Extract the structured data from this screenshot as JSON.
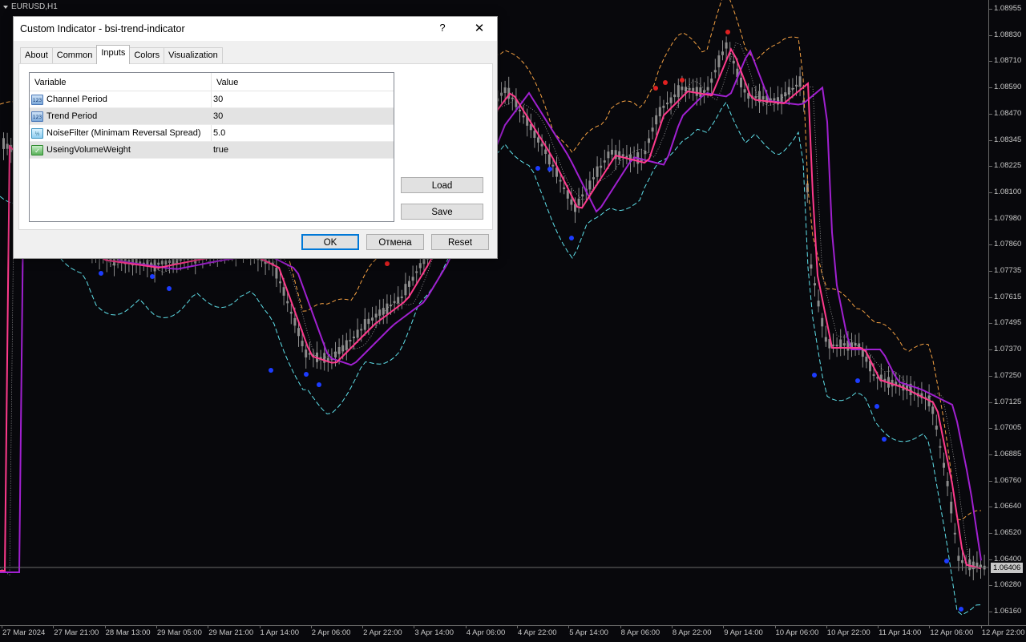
{
  "chart": {
    "symbol": "EURUSD,H1",
    "current_price": "1.06406",
    "price_labels": [
      "1.08955",
      "1.08830",
      "1.08710",
      "1.08590",
      "1.08470",
      "1.08345",
      "1.08225",
      "1.08100",
      "1.07980",
      "1.07860",
      "1.07735",
      "1.07615",
      "1.07495",
      "1.07370",
      "1.07250",
      "1.07125",
      "1.07005",
      "1.06885",
      "1.06760",
      "1.06640",
      "1.06520",
      "1.06400",
      "1.06280",
      "1.06160"
    ],
    "time_labels": [
      "27 Mar 2024",
      "27 Mar 21:00",
      "28 Mar 13:00",
      "29 Mar 05:00",
      "29 Mar 21:00",
      "1 Apr 14:00",
      "2 Apr 06:00",
      "2 Apr 22:00",
      "3 Apr 14:00",
      "4 Apr 06:00",
      "4 Apr 22:00",
      "5 Apr 14:00",
      "8 Apr 06:00",
      "8 Apr 22:00",
      "9 Apr 14:00",
      "10 Apr 06:00",
      "10 Apr 22:00",
      "11 Apr 14:00",
      "12 Apr 06:00",
      "12 Apr 22:00"
    ],
    "colors": {
      "background": "#08080c",
      "candle": "#8c8c8c",
      "upper_channel": "#f5a142",
      "lower_channel": "#5fe0ea",
      "trend_fast": "#ff3a8c",
      "trend_slow": "#a020d0",
      "reversal_up_dot": "#e02020",
      "reversal_down_dot": "#1c3cff",
      "guide_dots": "#bbbbbb",
      "price_line": "#6a6a6a"
    }
  },
  "dialog": {
    "title": "Custom Indicator - bsi-trend-indicator",
    "help_glyph": "?",
    "close_glyph": "✕",
    "tabs": [
      "About",
      "Common",
      "Inputs",
      "Colors",
      "Visualization"
    ],
    "active_tab": "Inputs",
    "grid": {
      "headers": [
        "Variable",
        "Value"
      ],
      "rows": [
        {
          "icon": "int",
          "icon_text": "123",
          "variable": "Channel Period",
          "value": "30"
        },
        {
          "icon": "int",
          "icon_text": "123",
          "variable": "Trend Period",
          "value": "30"
        },
        {
          "icon": "dbl",
          "icon_text": "½",
          "variable": "NoiseFilter (Minimam Reversal Spread)",
          "value": "5.0"
        },
        {
          "icon": "bool",
          "icon_text": "✓",
          "variable": "UseingVolumeWeight",
          "value": "true"
        }
      ]
    },
    "buttons": {
      "load": "Load",
      "save": "Save",
      "ok": "OK",
      "cancel": "Отмена",
      "reset": "Reset"
    }
  }
}
